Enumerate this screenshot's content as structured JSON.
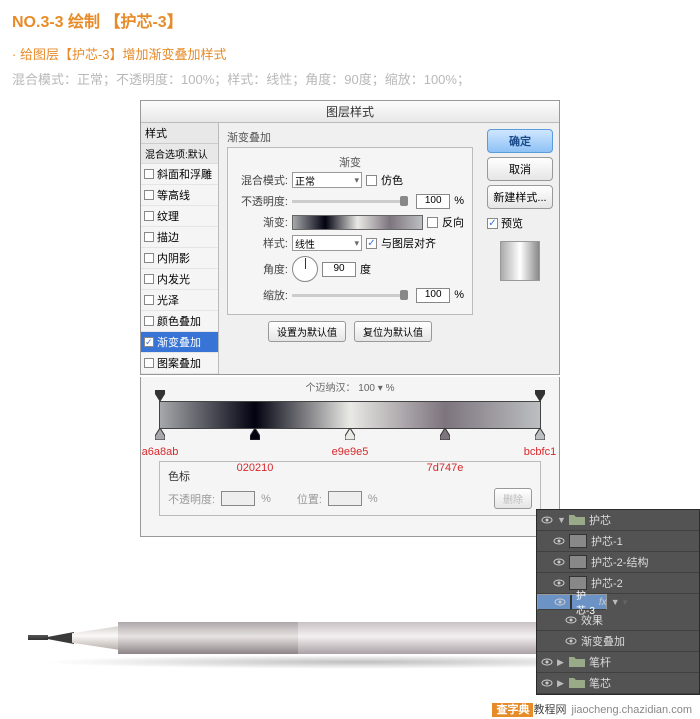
{
  "header": {
    "title": "NO.3-3 绘制 【护芯-3】",
    "subtitle": "· 给图层【护芯-3】增加渐变叠加样式",
    "params": "混合模式：正常；不透明度：100%；样式：线性；角度：90度；缩放：100%；"
  },
  "dialog": {
    "title": "图层样式",
    "list_header": "样式",
    "mix_default": "混合选项:默认",
    "items": [
      {
        "label": "斜面和浮雕",
        "checked": false
      },
      {
        "label": "等高线",
        "checked": false
      },
      {
        "label": "纹理",
        "checked": false
      },
      {
        "label": "描边",
        "checked": false
      },
      {
        "label": "内阴影",
        "checked": false
      },
      {
        "label": "内发光",
        "checked": false
      },
      {
        "label": "光泽",
        "checked": false
      },
      {
        "label": "颜色叠加",
        "checked": false
      },
      {
        "label": "渐变叠加",
        "checked": true,
        "active": true
      },
      {
        "label": "图案叠加",
        "checked": false
      }
    ],
    "group": {
      "section_title": "渐变叠加",
      "gradient_sub": "渐变",
      "blend_label": "混合模式:",
      "blend_value": "正常",
      "dither_label": "仿色",
      "opacity_label": "不透明度:",
      "opacity_value": "100",
      "opacity_unit": "%",
      "gradient_label": "渐变:",
      "reverse_label": "反向",
      "style_label": "样式:",
      "style_value": "线性",
      "align_label": "与图层对齐",
      "angle_label": "角度:",
      "angle_value": "90",
      "angle_unit": "度",
      "scale_label": "缩放:",
      "scale_value": "100",
      "scale_unit": "%",
      "set_default": "设置为默认值",
      "reset_default": "复位为默认值"
    },
    "buttons": {
      "ok": "确定",
      "cancel": "取消",
      "new_style": "新建样式...",
      "preview": "预览"
    }
  },
  "grad_editor": {
    "truncated_row": "个迈纳汉： 100 ▾ %",
    "stops": [
      {
        "pos": 0,
        "hex": "a6a8ab"
      },
      {
        "pos": 25,
        "hex": "020210"
      },
      {
        "pos": 50,
        "hex": "e9e9e5"
      },
      {
        "pos": 75,
        "hex": "7d747e"
      },
      {
        "pos": 100,
        "hex": "bcbfc1"
      }
    ],
    "section_label": "色标",
    "sub_labels": {
      "opacity": "不透明度:",
      "pct": "%",
      "pos": "位置:",
      "delete": "删除"
    }
  },
  "layers": {
    "items": [
      {
        "label": "护芯",
        "folder": true,
        "open": true,
        "indent": 0
      },
      {
        "label": "护芯-1",
        "indent": 1
      },
      {
        "label": "护芯-2-结构",
        "indent": 1
      },
      {
        "label": "护芯-2",
        "indent": 1
      },
      {
        "label": "护芯-3",
        "indent": 1,
        "selected": true,
        "fx": true
      },
      {
        "label": "效果",
        "indent": 2,
        "effect": true
      },
      {
        "label": "渐变叠加",
        "indent": 2,
        "effect": true
      },
      {
        "label": "笔杆",
        "folder": true,
        "open": false,
        "indent": 0
      },
      {
        "label": "笔芯",
        "folder": true,
        "open": false,
        "indent": 0
      }
    ],
    "fx_label": "fx"
  },
  "watermark": {
    "brand": "查字典",
    "suffix": "教程网",
    "url": "jiaocheng.chazidian.com"
  }
}
